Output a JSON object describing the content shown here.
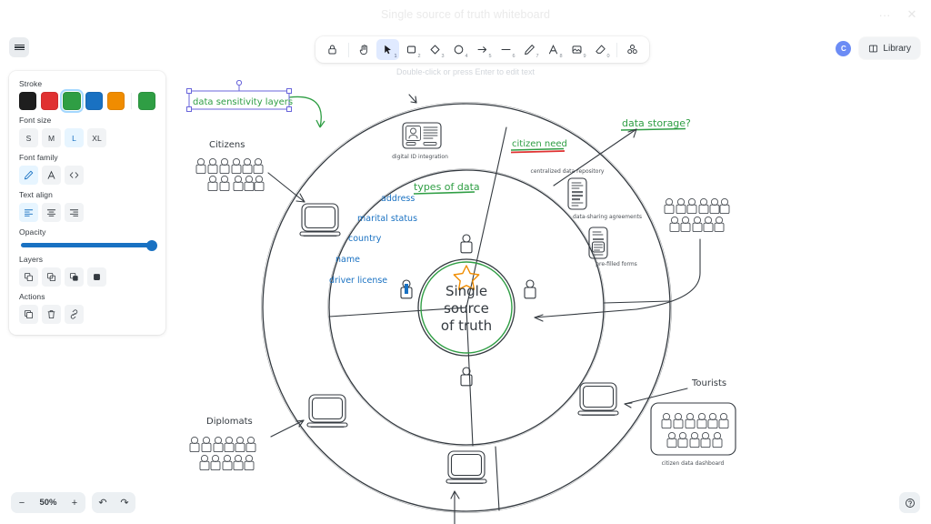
{
  "window": {
    "title": "Single source of truth whiteboard",
    "more_label": "···",
    "close_label": "✕"
  },
  "menu": {
    "hamburger_name": "menu"
  },
  "panel": {
    "stroke_label": "Stroke",
    "stroke_colors": [
      "#1e1e1e",
      "#e03131",
      "#2f9e44",
      "#1971c2",
      "#f08c00"
    ],
    "stroke_selected_index": 2,
    "current_color": "#2f9e44",
    "font_size_label": "Font size",
    "font_sizes": [
      "S",
      "M",
      "L",
      "XL"
    ],
    "font_size_selected": "L",
    "font_family_label": "Font family",
    "font_families": [
      "hand-drawn",
      "normal",
      "code"
    ],
    "font_family_selected": "hand-drawn",
    "text_align_label": "Text align",
    "text_aligns": [
      "left",
      "center",
      "right"
    ],
    "text_align_selected": "left",
    "opacity_label": "Opacity",
    "opacity_value": 100,
    "layers_label": "Layers",
    "layers": [
      "send-to-back",
      "send-backward",
      "bring-forward",
      "bring-to-front"
    ],
    "actions_label": "Actions",
    "actions": [
      "duplicate",
      "delete",
      "link"
    ]
  },
  "toolbar": {
    "tools": [
      {
        "name": "lock",
        "key": ""
      },
      {
        "name": "hand",
        "key": ""
      },
      {
        "name": "selection",
        "key": "1",
        "active": true
      },
      {
        "name": "rectangle",
        "key": "2"
      },
      {
        "name": "diamond",
        "key": "3"
      },
      {
        "name": "ellipse",
        "key": "4"
      },
      {
        "name": "arrow",
        "key": "5"
      },
      {
        "name": "line",
        "key": "6"
      },
      {
        "name": "draw",
        "key": "7"
      },
      {
        "name": "text",
        "key": "8"
      },
      {
        "name": "image",
        "key": "9"
      },
      {
        "name": "eraser",
        "key": "0"
      },
      {
        "name": "more-tools",
        "key": ""
      }
    ],
    "hint": "Double-click or press Enter to edit text"
  },
  "topright": {
    "avatar_initial": "C",
    "library_label": "Library"
  },
  "footer": {
    "zoom_out": "−",
    "zoom_level": "50%",
    "zoom_in": "+",
    "undo": "↶",
    "redo": "↷",
    "help": "?"
  },
  "whiteboard": {
    "selected_text": "data sensitivity layers",
    "center_label_lines": [
      "Single",
      "source",
      "of truth"
    ],
    "headings": {
      "types_of_data": "types of data",
      "citizen_need": "citizen need",
      "data_storage": "data storage?"
    },
    "data_types": [
      "address",
      "marital status",
      "country",
      "name",
      "driver license"
    ],
    "group_labels": {
      "citizens": "Citizens",
      "diplomats": "Diplomats",
      "tourists": "Tourists"
    },
    "captions": {
      "digital_id": "digital ID integration",
      "centralized_repo": "centralized data repository",
      "data_sharing": "data-sharing agreements",
      "prefilled_forms": "pre-filled forms",
      "citizen_dashboard": "citizen data dashboard"
    },
    "colors": {
      "green": "#2f9e44",
      "blue": "#1971c2",
      "red": "#e03131",
      "orange": "#f08c00",
      "ink": "#343a40",
      "selection": "#6965db"
    }
  }
}
